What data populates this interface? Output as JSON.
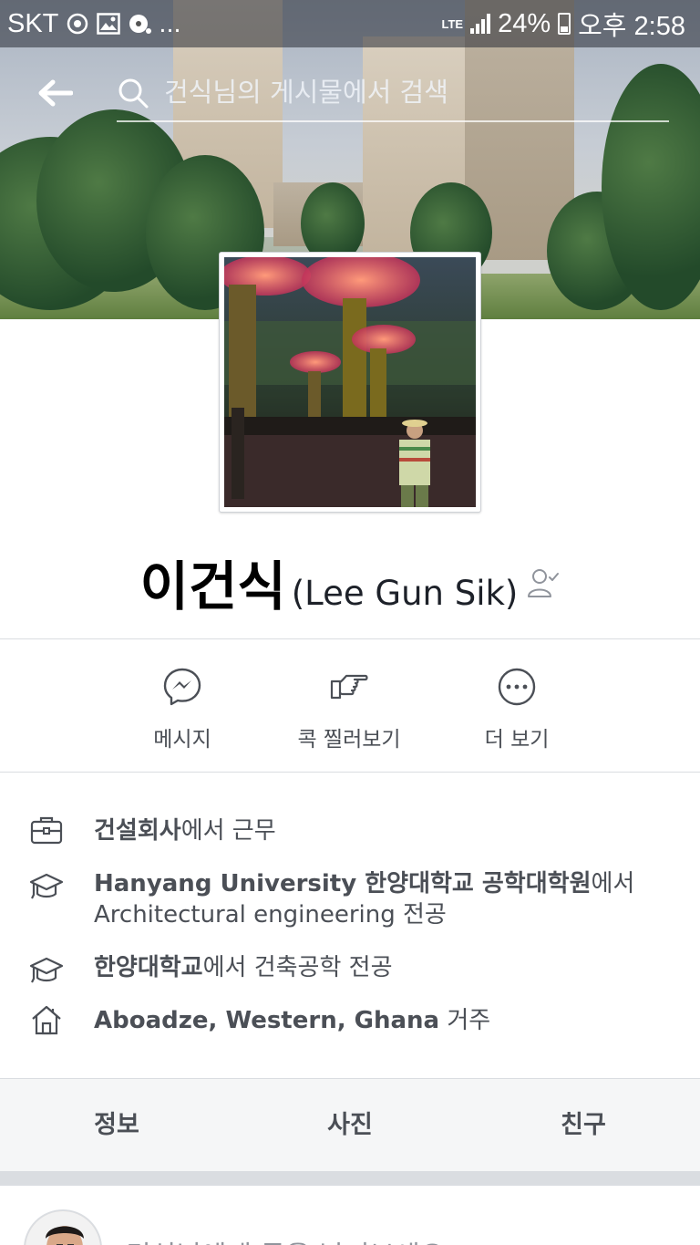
{
  "status_bar": {
    "carrier": "SKT",
    "more_indicator": "...",
    "network": "LTE",
    "battery": "24%",
    "time": "오후 2:58",
    "icons": [
      "sync-icon",
      "gallery-icon",
      "media-icon",
      "signal-icon",
      "battery-charging-icon"
    ]
  },
  "search": {
    "placeholder": "건식님의 게시물에서 검색"
  },
  "profile": {
    "name": "이건식",
    "alt_name": "(Lee Gun Sik)"
  },
  "actions": [
    {
      "label": "메시지",
      "icon": "messenger-icon"
    },
    {
      "label": "콕 찔러보기",
      "icon": "poke-icon"
    },
    {
      "label": "더 보기",
      "icon": "more-icon"
    }
  ],
  "intro": {
    "work": {
      "bold": "건설회사",
      "rest": "에서 근무",
      "icon": "briefcase-icon"
    },
    "grad_school": {
      "bold": "Hanyang University 한양대학교 공학대학원",
      "rest": "에서",
      "line2": "Architectural engineering 전공",
      "icon": "graduation-cap-icon"
    },
    "college": {
      "bold": "한양대학교",
      "rest": "에서 건축공학 전공",
      "icon": "graduation-cap-icon"
    },
    "lives": {
      "bold": "Aboadze, Western, Ghana",
      "rest": " 거주",
      "icon": "home-icon"
    }
  },
  "tabs": [
    {
      "label": "정보"
    },
    {
      "label": "사진"
    },
    {
      "label": "친구"
    }
  ],
  "composer": {
    "prompt": "건식님에게 글을 남겨보세요"
  },
  "colors": {
    "text_secondary": "#4b4f56",
    "divider": "#dadde1",
    "tab_bg": "#f5f6f7"
  }
}
